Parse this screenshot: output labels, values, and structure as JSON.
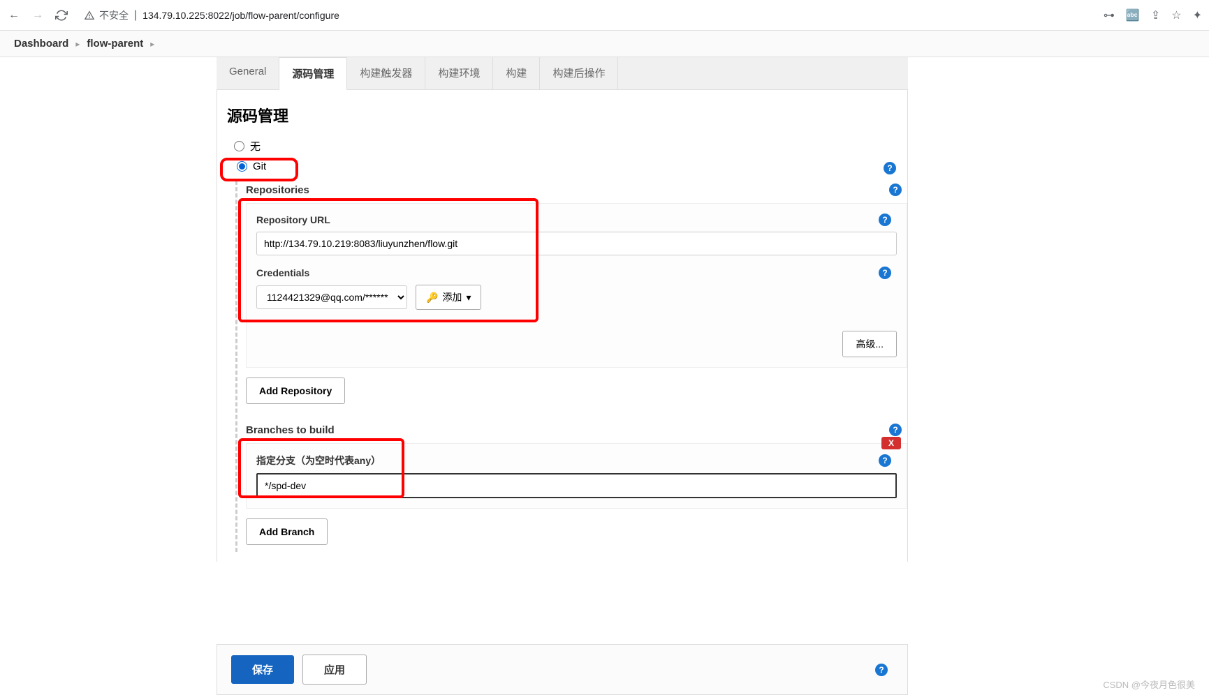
{
  "browser": {
    "insecure_label": "不安全",
    "url": "134.79.10.225:8022/job/flow-parent/configure"
  },
  "breadcrumb": {
    "items": [
      "Dashboard",
      "flow-parent"
    ]
  },
  "tabs": {
    "general": "General",
    "scm": "源码管理",
    "triggers": "构建触发器",
    "env": "构建环境",
    "build": "构建",
    "post": "构建后操作"
  },
  "section": {
    "title": "源码管理",
    "radio_none": "无",
    "radio_git": "Git"
  },
  "repos": {
    "label": "Repositories",
    "url_label": "Repository URL",
    "url_value": "http://134.79.10.219:8083/liuyunzhen/flow.git",
    "cred_label": "Credentials",
    "cred_value": "1124421329@qq.com/******",
    "add_label": "添加",
    "advanced": "高级...",
    "add_repo": "Add Repository"
  },
  "branches": {
    "label": "Branches to build",
    "branch_label": "指定分支（为空时代表any）",
    "branch_value": "*/spd-dev",
    "delete": "X",
    "add_branch": "Add Branch"
  },
  "footer": {
    "save": "保存",
    "apply": "应用"
  },
  "watermark": "CSDN @今夜月色很美"
}
